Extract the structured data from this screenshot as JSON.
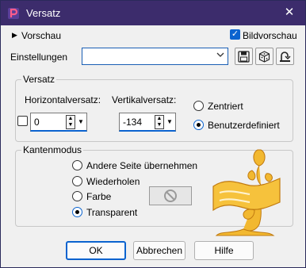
{
  "window": {
    "title": "Versatz",
    "close_glyph": "✕",
    "title_bar_color": "#3c2c6c"
  },
  "preview": {
    "toggle_glyph": "▶",
    "label": "Vorschau",
    "image_preview_label": "Bildvorschau",
    "image_preview_checked": true
  },
  "settings": {
    "label": "Einstellungen",
    "value": "",
    "tools": [
      "save-preset-icon",
      "random-settings-icon",
      "reset-icon"
    ]
  },
  "offset_group": {
    "title": "Versatz",
    "horizontal_label": "Horizontalversatz:",
    "horizontal_value": "0",
    "vertical_label": "Vertikalversatz:",
    "vertical_value": "-134",
    "link_checked": false,
    "centered_label": "Zentriert",
    "custom_label": "Benutzerdefiniert",
    "selected": "custom"
  },
  "edge_group": {
    "title": "Kantenmodus",
    "options": [
      {
        "label": "Andere Seite übernehmen",
        "selected": false
      },
      {
        "label": "Wiederholen",
        "selected": false
      },
      {
        "label": "Farbe",
        "selected": false
      },
      {
        "label": "Transparent",
        "selected": true
      }
    ]
  },
  "buttons": {
    "ok": "OK",
    "cancel": "Abbrechen",
    "help": "Hilfe"
  },
  "colors": {
    "accent": "#0b63cf",
    "watermark": "#e8a317"
  }
}
